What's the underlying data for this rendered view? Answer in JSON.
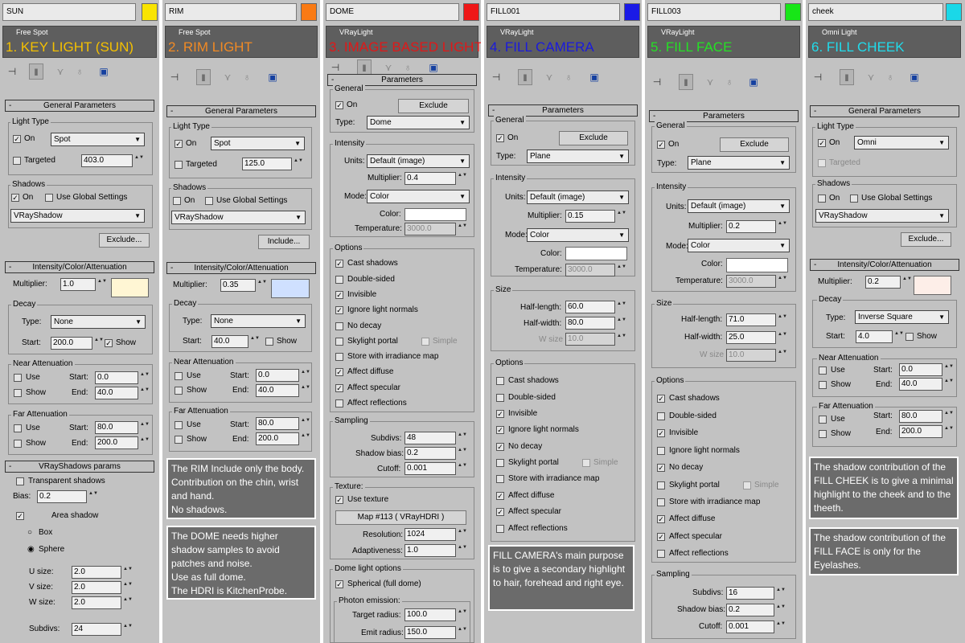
{
  "panels": [
    {
      "name": "SUN",
      "color": "#f9e400",
      "type": "Free Spot",
      "title": "1. KEY LIGHT (SUN)",
      "title_color": "#f4c000"
    },
    {
      "name": "RIM",
      "color": "#f97a14",
      "type": "Free Spot",
      "title": "2. RIM LIGHT",
      "title_color": "#f18a24"
    },
    {
      "name": "DOME",
      "color": "#ee1717",
      "type": "VRayLight",
      "title": "3. IMAGE BASED LIGHT",
      "title_color": "#e01818"
    },
    {
      "name": "FILL001",
      "color": "#1a1ae6",
      "type": "VRayLight",
      "title": "4. FILL CAMERA",
      "title_color": "#1a1adc"
    },
    {
      "name": "FILL003",
      "color": "#17e617",
      "type": "VRayLight",
      "title": "5. FILL FACE",
      "title_color": "#25e025"
    },
    {
      "name": "cheek",
      "color": "#1ad8e8",
      "type": "Omni Light",
      "title": "6. FILL CHEEK",
      "title_color": "#20dcec"
    }
  ],
  "common": {
    "general_params": "General Parameters",
    "light_type": "Light Type",
    "on": "On",
    "targeted": "Targeted",
    "shadows": "Shadows",
    "use_global": "Use Global Settings",
    "exclude_btn": "Exclude...",
    "include_btn": "Include...",
    "intensity_rollout": "Intensity/Color/Attenuation",
    "multiplier": "Multiplier:",
    "decay": "Decay",
    "type": "Type:",
    "start": "Start:",
    "show": "Show",
    "near_att": "Near Attenuation",
    "far_att": "Far Attenuation",
    "use": "Use",
    "start2": "Start:",
    "end": "End:",
    "parameters": "Parameters",
    "general": "General",
    "exclude": "Exclude",
    "intensity": "Intensity",
    "units": "Units:",
    "units_val": "Default (image)",
    "mult2": "Multiplier:",
    "mode": "Mode:",
    "mode_val": "Color",
    "color": "Color:",
    "temperature": "Temperature:",
    "temp_val": "3000.0",
    "size": "Size",
    "half_length": "Half-length:",
    "half_width": "Half-width:",
    "w_size": "W size",
    "options": "Options",
    "cast_shadows": "Cast shadows",
    "double_sided": "Double-sided",
    "invisible": "Invisible",
    "ignore_normals": "Ignore light normals",
    "no_decay": "No decay",
    "skylight_portal": "Skylight portal",
    "simple": "Simple",
    "store_irr": "Store with irradiance map",
    "affect_diffuse": "Affect diffuse",
    "affect_specular": "Affect specular",
    "affect_reflections": "Affect reflections",
    "sampling": "Sampling",
    "subdivs": "Subdivs:",
    "shadow_bias": "Shadow bias:",
    "cutoff": "Cutoff:",
    "minus": "-",
    "vrayshadow": "VRayShadow"
  },
  "p1": {
    "type_val": "Spot",
    "target_val": "403.0",
    "mult": "1.0",
    "mult_color": "#fff6d4",
    "decay_type": "None",
    "decay_start": "200.0",
    "near_start": "0.0",
    "near_end": "40.0",
    "far_start": "80.0",
    "far_end": "200.0",
    "vs_rollout": "VRayShadows params",
    "transparent": "Transparent shadows",
    "bias": "Bias:",
    "bias_val": "0.2",
    "area": "Area shadow",
    "box": "Box",
    "sphere": "Sphere",
    "usize": "U size:",
    "vsize": "V size:",
    "wsize": "W size:",
    "usize_val": "2.0",
    "vsize_val": "2.0",
    "wsize_val": "2.0",
    "subdivs": "Subdivs:",
    "subdivs_val": "24"
  },
  "p2": {
    "type_val": "Spot",
    "target_val": "125.0",
    "mult": "0.35",
    "mult_color": "#cfe0ff",
    "decay_type": "None",
    "decay_start": "40.0",
    "near_start": "0.0",
    "near_end": "40.0",
    "far_start": "80.0",
    "far_end": "200.0",
    "note1": "The RIM Include only the body. Contribution on the chin, wrist and hand.\nNo shadows.",
    "note2": "The DOME needs higher shadow samples to avoid patches and noise.\nUse as full dome.\nThe HDRI is KitchenProbe."
  },
  "p3": {
    "type_val": "Dome",
    "mult": "0.4",
    "subdivs": "48",
    "shadow_bias": "0.2",
    "cutoff": "0.001",
    "texture": "Texture:",
    "use_texture": "Use texture",
    "map": "Map #113  ( VRayHDRI )",
    "resolution": "Resolution:",
    "resolution_val": "1024",
    "adaptiveness": "Adaptiveness:",
    "adaptiveness_val": "1.0",
    "dome_opts": "Dome light options",
    "spherical": "Spherical (full dome)",
    "photon": "Photon emission:",
    "target_radius": "Target radius:",
    "target_radius_val": "100.0",
    "emit_radius": "Emit radius:",
    "emit_radius_val": "150.0"
  },
  "p4": {
    "type_val": "Plane",
    "mult": "0.15",
    "half_length": "60.0",
    "half_width": "80.0",
    "w_size": "10.0",
    "note": "FILL CAMERA's main purpose is to give a secondary highlight to hair, forehead and right eye."
  },
  "p5": {
    "type_val": "Plane",
    "mult": "0.2",
    "half_length": "71.0",
    "half_width": "25.0",
    "w_size": "10.0",
    "subdivs": "16",
    "shadow_bias": "0.2",
    "cutoff": "0.001"
  },
  "p6": {
    "type_val": "Omni",
    "mult": "0.2",
    "mult_color": "#fdeee8",
    "decay_type": "Inverse Square",
    "decay_start": "4.0",
    "near_start": "0.0",
    "near_end": "40.0",
    "far_start": "80.0",
    "far_end": "200.0",
    "note1": "The shadow contribution of the FILL CHEEK is to give a minimal highlight to the cheek and to the theeth.",
    "note2": "The shadow contribution of the FILL FACE is only for the Eyelashes."
  }
}
